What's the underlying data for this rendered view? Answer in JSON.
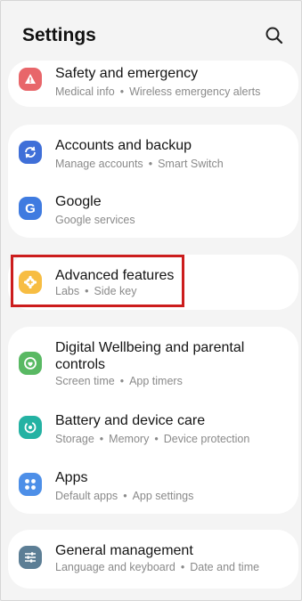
{
  "header": {
    "title": "Settings",
    "search_icon": "search-icon"
  },
  "items": {
    "safety": {
      "label": "Safety and emergency",
      "sub": [
        "Medical info",
        "Wireless emergency alerts"
      ],
      "icon": "alert-icon",
      "color": "#e8666a"
    },
    "accounts": {
      "label": "Accounts and backup",
      "sub": [
        "Manage accounts",
        "Smart Switch"
      ],
      "icon": "sync-icon",
      "color": "#3f6fd8"
    },
    "google": {
      "label": "Google",
      "sub": [
        "Google services"
      ],
      "icon": "google-icon",
      "color": "#3f7be0"
    },
    "advanced": {
      "label": "Advanced features",
      "sub": [
        "Labs",
        "Side key"
      ],
      "icon": "gear-plus-icon",
      "color": "#f7bd43"
    },
    "wellbeing": {
      "label_line1": "Digital Wellbeing and parental",
      "label_line2": "controls",
      "sub": [
        "Screen time",
        "App timers"
      ],
      "icon": "wellbeing-icon",
      "color": "#59b963"
    },
    "battery": {
      "label": "Battery and device care",
      "sub": [
        "Storage",
        "Memory",
        "Device protection"
      ],
      "icon": "battery-care-icon",
      "color": "#24b2a3"
    },
    "apps": {
      "label": "Apps",
      "sub": [
        "Default apps",
        "App settings"
      ],
      "icon": "apps-grid-icon",
      "color": "#4d8fe8"
    },
    "general": {
      "label": "General management",
      "sub": [
        "Language and keyboard",
        "Date and time"
      ],
      "icon": "sliders-icon",
      "color": "#5c7e95"
    }
  },
  "highlight_color": "#cc1d1d"
}
